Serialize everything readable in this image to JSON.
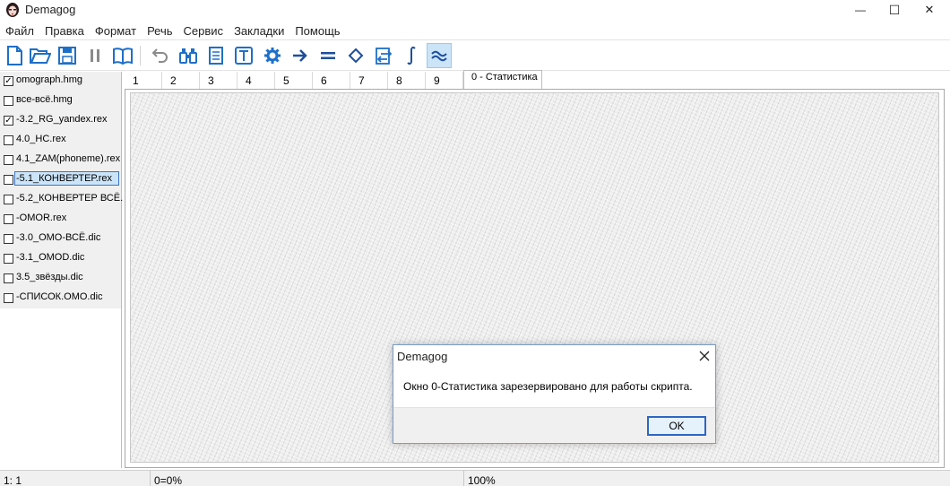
{
  "window": {
    "title": "Demagog",
    "min_glyph": "—",
    "max_glyph": "☐",
    "close_glyph": "✕"
  },
  "menu": {
    "items": [
      "Файл",
      "Правка",
      "Формат",
      "Речь",
      "Сервис",
      "Закладки",
      "Помощь"
    ]
  },
  "toolbar": {
    "buttons": [
      "new-file",
      "open-folder",
      "save",
      "pause",
      "book",
      "undo",
      "binoculars",
      "document",
      "text-t",
      "gear",
      "arrow-right",
      "equals",
      "diamond",
      "transfer",
      "integral",
      "approx"
    ],
    "active_button": "approx",
    "accent_color": "#1e6fc8"
  },
  "files": {
    "items": [
      {
        "label": "omograph.hmg",
        "checked": true
      },
      {
        "label": "все-всё.hmg",
        "checked": false
      },
      {
        "label": "-3.2_RG_yandex.rex",
        "checked": true
      },
      {
        "label": "4.0_HC.rex",
        "checked": false
      },
      {
        "label": "4.1_ZAM(phoneme).rex",
        "checked": false
      },
      {
        "label": "-5.1_КОНВЕРТЕР.rex",
        "checked": false,
        "selected": true
      },
      {
        "label": "-5.2_КОНВЕРТЕР ВСЁ.",
        "checked": false
      },
      {
        "label": "-OMOR.rex",
        "checked": false
      },
      {
        "label": "-3.0_OMO-ВСЁ.dic",
        "checked": false
      },
      {
        "label": "-3.1_OMOD.dic",
        "checked": false
      },
      {
        "label": "3.5_звёзды.dic",
        "checked": false
      },
      {
        "label": "-СПИСОК.OMO.dic",
        "checked": false
      }
    ]
  },
  "tabs": {
    "items": [
      "1",
      "2",
      "3",
      "4",
      "5",
      "6",
      "7",
      "8",
      "9",
      "0 - Статистика"
    ],
    "active": "0 - Статистика"
  },
  "dialog": {
    "title": "Demagog",
    "message": "Окно 0-Статистика зарезервировано для работы скрипта.",
    "ok_label": "OK"
  },
  "status": {
    "position": "1: 1",
    "percent_a": "0=0%",
    "zoom": "100%"
  }
}
